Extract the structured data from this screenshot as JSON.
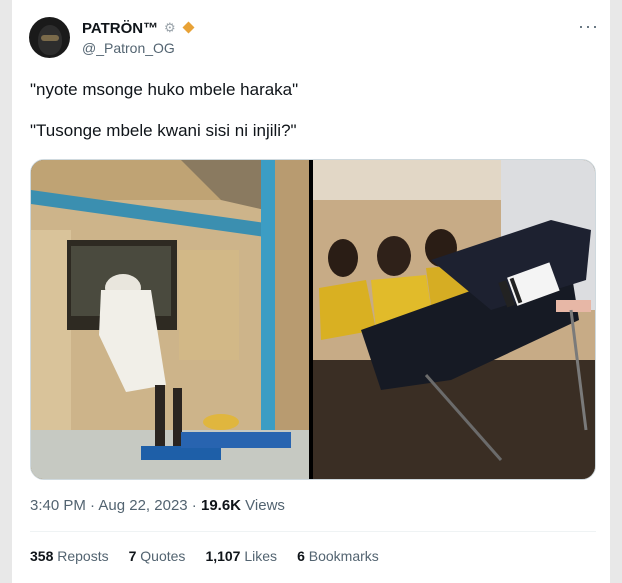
{
  "author": {
    "name": "PATRÖN™",
    "decoration": "⚙",
    "handle": "@_Patron_OG",
    "verified_color": "#e8a236"
  },
  "more_label": "···",
  "tweet": {
    "line1": "\"nyote msonge huko mbele haraka\"",
    "line2": "\"Tusonge mbele kwani sisi ni injili?\""
  },
  "meta": {
    "time": "3:40 PM",
    "separator1": " · ",
    "date": "Aug 22, 2023",
    "separator2": " · ",
    "views_count": "19.6K",
    "views_label": " Views"
  },
  "stats": {
    "reposts_count": "358",
    "reposts_label": " Reposts",
    "quotes_count": "7",
    "quotes_label": " Quotes",
    "likes_count": "1,107",
    "likes_label": " Likes",
    "bookmarks_count": "6",
    "bookmarks_label": " Bookmarks"
  }
}
